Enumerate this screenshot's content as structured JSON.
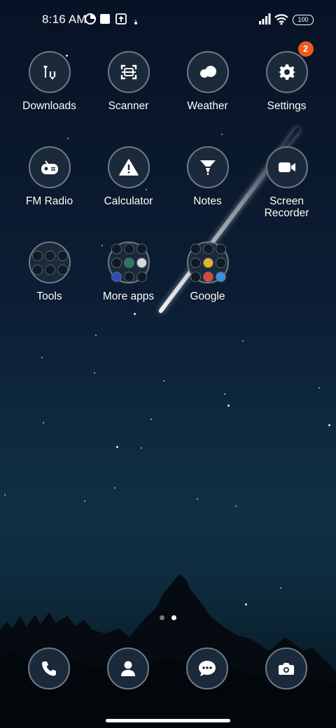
{
  "status_bar": {
    "time": "8:16 AM",
    "battery": "100",
    "icons": [
      "data-saver-icon",
      "square-icon",
      "upload-icon",
      "dot-icon",
      "signal-icon",
      "wifi-icon",
      "battery-icon"
    ]
  },
  "apps": [
    {
      "label": "Downloads",
      "icon": "download-icon"
    },
    {
      "label": "Scanner",
      "icon": "scanner-icon"
    },
    {
      "label": "Weather",
      "icon": "cloud-icon"
    },
    {
      "label": "Settings",
      "icon": "gear-icon",
      "badge": "2"
    },
    {
      "label": "FM Radio",
      "icon": "radio-icon"
    },
    {
      "label": "Calculator",
      "icon": "warning-icon"
    },
    {
      "label": "Notes",
      "icon": "funnel-icon"
    },
    {
      "label": "Screen Recorder",
      "icon": "video-camera-icon"
    },
    {
      "label": "Tools",
      "icon": "folder-icon"
    },
    {
      "label": "More apps",
      "icon": "folder-icon"
    },
    {
      "label": "Google",
      "icon": "folder-icon"
    }
  ],
  "page_indicator": {
    "pages": 2,
    "current": 2
  },
  "dock": [
    {
      "name": "phone",
      "icon": "phone-icon"
    },
    {
      "name": "contacts",
      "icon": "person-icon"
    },
    {
      "name": "messages",
      "icon": "chat-bubble-icon"
    },
    {
      "name": "camera",
      "icon": "camera-icon"
    }
  ],
  "colors": {
    "badge": "#ef5a1a",
    "icon_ring": "#6f7a86",
    "icon_fill": "#1b2a3a"
  }
}
